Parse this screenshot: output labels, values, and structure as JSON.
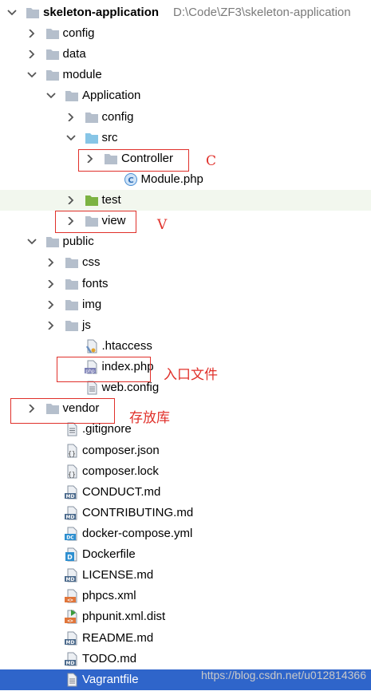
{
  "tree": [
    {
      "name": "skeleton-application-folder",
      "label": "skeleton-application",
      "path": "D:\\Code\\ZF3\\skeleton-application",
      "depth": 0,
      "arrow": "down",
      "icon": "folder",
      "bold": true
    },
    {
      "name": "folder-config",
      "label": "config",
      "depth": 1,
      "arrow": "right",
      "icon": "folder"
    },
    {
      "name": "folder-data",
      "label": "data",
      "depth": 1,
      "arrow": "right",
      "icon": "folder"
    },
    {
      "name": "folder-module",
      "label": "module",
      "depth": 1,
      "arrow": "down",
      "icon": "folder"
    },
    {
      "name": "folder-application",
      "label": "Application",
      "depth": 2,
      "arrow": "down",
      "icon": "folder"
    },
    {
      "name": "folder-application-config",
      "label": "config",
      "depth": 3,
      "arrow": "right",
      "icon": "folder"
    },
    {
      "name": "folder-src",
      "label": "src",
      "depth": 3,
      "arrow": "down",
      "icon": "folder-src"
    },
    {
      "name": "folder-controller",
      "label": "Controller",
      "depth": 4,
      "arrow": "right",
      "icon": "folder"
    },
    {
      "name": "file-module-php",
      "label": "Module.php",
      "depth": 5,
      "arrow": "none",
      "icon": "class"
    },
    {
      "name": "folder-test",
      "label": "test",
      "depth": 3,
      "arrow": "right",
      "icon": "folder-test",
      "highlight": true
    },
    {
      "name": "folder-view",
      "label": "view",
      "depth": 3,
      "arrow": "right",
      "icon": "folder"
    },
    {
      "name": "folder-public",
      "label": "public",
      "depth": 1,
      "arrow": "down",
      "icon": "folder"
    },
    {
      "name": "folder-css",
      "label": "css",
      "depth": 2,
      "arrow": "right",
      "icon": "folder"
    },
    {
      "name": "folder-fonts",
      "label": "fonts",
      "depth": 2,
      "arrow": "right",
      "icon": "folder"
    },
    {
      "name": "folder-img",
      "label": "img",
      "depth": 2,
      "arrow": "right",
      "icon": "folder"
    },
    {
      "name": "folder-js",
      "label": "js",
      "depth": 2,
      "arrow": "right",
      "icon": "folder"
    },
    {
      "name": "file-htaccess",
      "label": ".htaccess",
      "depth": 3,
      "arrow": "none",
      "icon": "htaccess"
    },
    {
      "name": "file-index-php",
      "label": "index.php",
      "depth": 3,
      "arrow": "none",
      "icon": "php"
    },
    {
      "name": "file-web-config",
      "label": "web.config",
      "depth": 3,
      "arrow": "none",
      "icon": "text"
    },
    {
      "name": "folder-vendor",
      "label": "vendor",
      "depth": 1,
      "arrow": "right",
      "icon": "folder"
    },
    {
      "name": "file-gitignore",
      "label": ".gitignore",
      "depth": 2,
      "arrow": "none",
      "icon": "text"
    },
    {
      "name": "file-composer-json",
      "label": "composer.json",
      "depth": 2,
      "arrow": "none",
      "icon": "json"
    },
    {
      "name": "file-composer-lock",
      "label": "composer.lock",
      "depth": 2,
      "arrow": "none",
      "icon": "json"
    },
    {
      "name": "file-conduct-md",
      "label": "CONDUCT.md",
      "depth": 2,
      "arrow": "none",
      "icon": "md"
    },
    {
      "name": "file-contributing-md",
      "label": "CONTRIBUTING.md",
      "depth": 2,
      "arrow": "none",
      "icon": "md"
    },
    {
      "name": "file-docker-compose-yml",
      "label": "docker-compose.yml",
      "depth": 2,
      "arrow": "none",
      "icon": "dc"
    },
    {
      "name": "file-dockerfile",
      "label": "Dockerfile",
      "depth": 2,
      "arrow": "none",
      "icon": "docker"
    },
    {
      "name": "file-license-md",
      "label": "LICENSE.md",
      "depth": 2,
      "arrow": "none",
      "icon": "md"
    },
    {
      "name": "file-phpcs-xml",
      "label": "phpcs.xml",
      "depth": 2,
      "arrow": "none",
      "icon": "xml"
    },
    {
      "name": "file-phpunit-xml-dist",
      "label": "phpunit.xml.dist",
      "depth": 2,
      "arrow": "none",
      "icon": "xmlrun"
    },
    {
      "name": "file-readme-md",
      "label": "README.md",
      "depth": 2,
      "arrow": "none",
      "icon": "md"
    },
    {
      "name": "file-todo-md",
      "label": "TODO.md",
      "depth": 2,
      "arrow": "none",
      "icon": "md"
    },
    {
      "name": "file-vagrantfile",
      "label": "Vagrantfile",
      "depth": 2,
      "arrow": "none",
      "icon": "vagrant",
      "selected": true
    }
  ],
  "annotations": {
    "controller": "C",
    "view": "V",
    "entry": "入口文件",
    "vendor": "存放库"
  },
  "watermark": "https://blog.csdn.net/u012814366",
  "colors": {
    "folder": "#b5bfcc",
    "folder_src": "#87c5e6",
    "folder_test": "#7cb342",
    "selection": "#2f65ca",
    "annotation": "#e0302a"
  }
}
